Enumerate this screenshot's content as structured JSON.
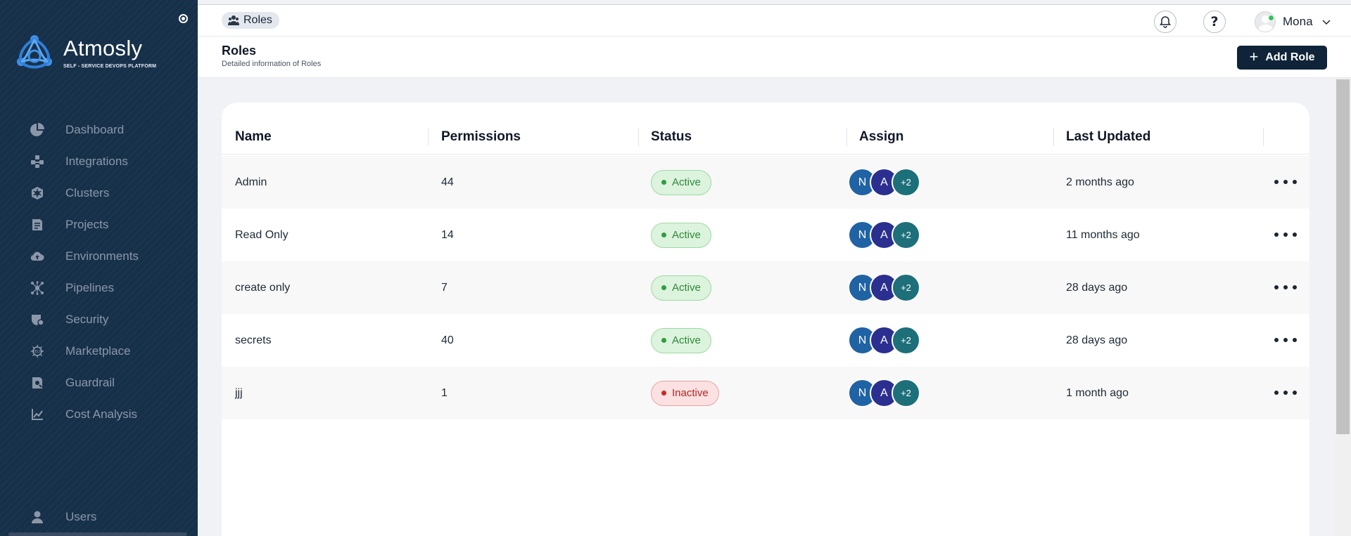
{
  "app": {
    "name": "Atmosly",
    "tagline": "SELF - SERVICE DEVOPS PLATFORM"
  },
  "sidebar": {
    "items": [
      {
        "label": "Dashboard",
        "icon": "pie-chart-icon"
      },
      {
        "label": "Integrations",
        "icon": "integrations-icon"
      },
      {
        "label": "Clusters",
        "icon": "kubernetes-icon"
      },
      {
        "label": "Projects",
        "icon": "projects-icon"
      },
      {
        "label": "Environments",
        "icon": "cloud-upload-icon"
      },
      {
        "label": "Pipelines",
        "icon": "pipelines-icon"
      },
      {
        "label": "Security",
        "icon": "shield-icon"
      },
      {
        "label": "Marketplace",
        "icon": "helm-icon"
      },
      {
        "label": "Guardrail",
        "icon": "guardrail-icon"
      },
      {
        "label": "Cost Analysis",
        "icon": "cost-chart-icon"
      }
    ],
    "bottom_items": [
      {
        "label": "Users",
        "icon": "user-icon"
      }
    ]
  },
  "topbar": {
    "breadcrumb": "Roles",
    "user_name": "Mona"
  },
  "header": {
    "title": "Roles",
    "subtitle": "Detailed information of Roles",
    "add_button": "Add Role"
  },
  "table": {
    "columns": [
      "Name",
      "Permissions",
      "Status",
      "Assign",
      "Last Updated"
    ],
    "rows": [
      {
        "name": "Admin",
        "permissions": "44",
        "status": "Active",
        "assign": [
          "N",
          "A",
          "+2"
        ],
        "updated": "2 months ago"
      },
      {
        "name": "Read Only",
        "permissions": "14",
        "status": "Active",
        "assign": [
          "N",
          "A",
          "+2"
        ],
        "updated": "11 months ago"
      },
      {
        "name": "create only",
        "permissions": "7",
        "status": "Active",
        "assign": [
          "N",
          "A",
          "+2"
        ],
        "updated": "28 days ago"
      },
      {
        "name": "secrets",
        "permissions": "40",
        "status": "Active",
        "assign": [
          "N",
          "A",
          "+2"
        ],
        "updated": "28 days ago"
      },
      {
        "name": "jjj",
        "permissions": "1",
        "status": "Inactive",
        "assign": [
          "N",
          "A",
          "+2"
        ],
        "updated": "1 month ago"
      }
    ]
  },
  "colors": {
    "sidebar_bg": "#17304a",
    "primary_button": "#0f2438",
    "active_green": "#2f9e3e",
    "inactive_red": "#c62828"
  }
}
